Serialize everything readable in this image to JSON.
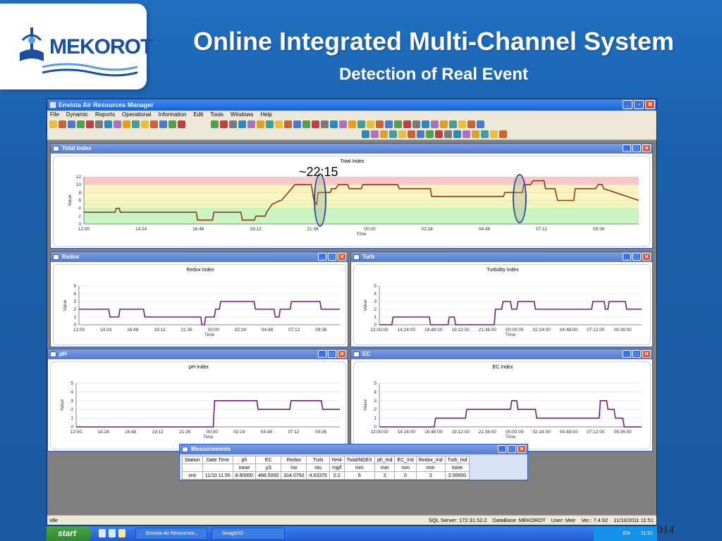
{
  "slide": {
    "logo_text": "MEKOROT",
    "title": "Online Integrated Multi-Channel System",
    "subtitle": "Detection of Real Event",
    "footer_num": "014"
  },
  "app": {
    "title": "Envista Air Resources Manager",
    "menu": [
      "File",
      "Dynamic",
      "Reports",
      "Operational",
      "Information",
      "Edit",
      "Tools",
      "Windows",
      "Help"
    ],
    "status": {
      "left": "Idle",
      "sql": "SQL Server: 172.31.52.2",
      "database": "DataBase: MEKOROT",
      "user": "User: Meir",
      "version": "Ver.: 7.4.92",
      "datetime": "11/10/2011 11:51"
    }
  },
  "windows": {
    "total": {
      "title": "Total Index",
      "chart_title": "Total Index"
    },
    "redox": {
      "title": "Redox",
      "chart_title": "Redox Index"
    },
    "turb": {
      "title": "Turb",
      "chart_title": "Turbidity Index"
    },
    "ph": {
      "title": "pH",
      "chart_title": "pH Index"
    },
    "ec": {
      "title": "EC",
      "chart_title": "EC Index"
    }
  },
  "annotation": "~22:15",
  "measurements": {
    "title": "Measurements",
    "headers": [
      "Station",
      "Date Time",
      "ph",
      "EC",
      "Redox",
      "Turb",
      "NH4",
      "TotalINDEX",
      "ph_Ind",
      "EC_Ind",
      "Redox_Ind",
      "Turb_Ind"
    ],
    "units": [
      "",
      "",
      "none",
      "µS",
      "mv",
      "ntu",
      "mg/l",
      "mm",
      "mm",
      "mm",
      "mm",
      "none"
    ],
    "row": [
      "snir",
      "11/10 11:55",
      "8.60000",
      "486.5000",
      "314.0750",
      "4.83375",
      "0.2",
      "6",
      "2",
      "0",
      "2",
      "2.00000"
    ]
  },
  "taskbar": {
    "start": "start",
    "items": [
      "Envista Air Resources...",
      "SnagIt/32"
    ],
    "tray_lang": "EN",
    "tray_time": "11:51"
  },
  "chart_data": [
    {
      "type": "line",
      "title": "Total Index",
      "xlabel": "Time",
      "ylabel": "Value",
      "ylim": [
        0,
        12
      ],
      "yticks": [
        0,
        2,
        4,
        6,
        8,
        10,
        12
      ],
      "xticks": [
        "12:00",
        "14:24",
        "16:48",
        "19:12",
        "21:36",
        "00:00",
        "02:24",
        "04:48",
        "07:12",
        "09:36"
      ],
      "bands": [
        {
          "from": 0,
          "to": 4,
          "color": "#c8f5c0"
        },
        {
          "from": 4,
          "to": 6,
          "color": "#f2f5b8"
        },
        {
          "from": 6,
          "to": 8,
          "color": "#fbf5c0"
        },
        {
          "from": 8,
          "to": 10,
          "color": "#faf0c0"
        },
        {
          "from": 10,
          "to": 12,
          "color": "#f8c8c8"
        }
      ],
      "series": [
        {
          "color": "#8b3a1a",
          "x_hours": [
            0,
            2.3,
            2.4,
            2.6,
            2.7,
            8.3,
            8.4,
            9.5,
            9.6,
            11.6,
            11.7,
            12.6,
            12.7,
            13.4,
            13.5,
            13.7,
            13.9,
            14.5,
            14.6,
            15.6,
            15.7,
            16.0,
            16.1,
            16.8,
            17.0,
            17.2,
            17.3,
            18.2,
            18.3,
            18.6,
            18.8,
            19.5,
            19.6,
            20.5,
            20.6,
            23.2,
            23.3,
            25.6,
            25.7,
            27.3,
            27.4,
            31.0,
            31.1,
            32.4,
            32.5,
            33.0,
            33.2,
            34.0,
            34.1,
            34.8,
            35.0,
            36.2,
            36.3,
            37.8,
            38.0,
            38.3,
            38.4,
            41.0
          ],
          "values": [
            3,
            3,
            4,
            4,
            3,
            3,
            1,
            1,
            3,
            3,
            1,
            1,
            2,
            2,
            3,
            4,
            5,
            6,
            6,
            10,
            10,
            10,
            10,
            10,
            6,
            5,
            8,
            8,
            9,
            9,
            10,
            10,
            9,
            9,
            10,
            10,
            9,
            9,
            7,
            7,
            7,
            7,
            8,
            8,
            10,
            10,
            11,
            11,
            9,
            9,
            6,
            6,
            9,
            9,
            10,
            10,
            9,
            6
          ]
        }
      ]
    },
    {
      "type": "line",
      "title": "Redox Index",
      "xlabel": "Time",
      "ylabel": "Value",
      "ylim": [
        0,
        5
      ],
      "xticks": [
        "12:00",
        "14:24",
        "16:48",
        "19:12",
        "21:36",
        "00:00",
        "02:24",
        "04:48",
        "07:12",
        "09:36"
      ],
      "series": [
        {
          "color": "#7b1a7b",
          "x_hours": [
            0,
            2.4,
            2.5,
            3.2,
            3.3,
            5.2,
            5.3,
            8.0,
            8.1,
            9.8,
            9.9,
            10.1,
            10.2,
            10.9,
            11.0,
            11.3,
            11.4,
            11.9,
            12.0,
            14.1,
            14.2,
            15.7,
            15.8,
            16.1,
            16.2,
            17.0,
            17.1,
            17.3,
            17.4,
            19.4,
            19.5,
            21.0
          ],
          "values": [
            2,
            2,
            1,
            1,
            2,
            2,
            1,
            1,
            1,
            1,
            0,
            0,
            1,
            1,
            2,
            2,
            3,
            3,
            3,
            3,
            2,
            2,
            1,
            1,
            2,
            2,
            3,
            3,
            3,
            3,
            2,
            2
          ]
        }
      ]
    },
    {
      "type": "line",
      "title": "Turbidity Index",
      "xlabel": "Time",
      "ylabel": "Value",
      "ylim": [
        0,
        5
      ],
      "xticks": [
        "12:00:00",
        "14:24:00",
        "16:48:00",
        "19:12:00",
        "21:36:00",
        "00:00:00",
        "02:24:00",
        "04:48:00",
        "07:12:00",
        "09:36:00"
      ],
      "series": [
        {
          "color": "#7b1a7b",
          "x_hours": [
            0,
            1.0,
            1.1,
            4.0,
            4.1,
            5.5,
            5.6,
            6.0,
            6.1,
            9.2,
            9.3,
            9.8,
            9.9,
            10.5,
            10.6,
            11.0,
            11.1,
            12.4,
            12.5,
            17.0,
            17.1,
            18.0,
            18.1,
            18.3,
            18.4,
            19.7,
            19.8,
            21.0
          ],
          "values": [
            0,
            0,
            1,
            1,
            0,
            0,
            1,
            1,
            0,
            0,
            2,
            2,
            3,
            3,
            2,
            2,
            3,
            3,
            2,
            2,
            3,
            3,
            2,
            2,
            3,
            3,
            2,
            2
          ]
        }
      ]
    },
    {
      "type": "line",
      "title": "pH Index",
      "xlabel": "Time",
      "ylabel": "Value",
      "ylim": [
        0,
        5
      ],
      "xticks": [
        "12:00",
        "14:24",
        "16:48",
        "19:12",
        "21:36",
        "00:00",
        "02:24",
        "04:48",
        "07:12",
        "09:36"
      ],
      "series": [
        {
          "color": "#7b1a7b",
          "x_hours": [
            0,
            10.4,
            10.5,
            10.9,
            11.0,
            12.3,
            12.4,
            13.7,
            13.8,
            16.2,
            16.3,
            17.4,
            17.5,
            18.6,
            18.7,
            20.0
          ],
          "values": [
            0,
            0,
            3,
            3,
            3,
            3,
            3,
            3,
            2,
            2,
            3,
            3,
            3,
            3,
            2,
            2
          ]
        }
      ]
    },
    {
      "type": "line",
      "title": "EC Index",
      "xlabel": "Time",
      "ylabel": "Value",
      "ylim": [
        0,
        5
      ],
      "xticks": [
        "12:00:00",
        "14:24:00",
        "16:48:00",
        "19:12:00",
        "21:36:00",
        "00:00:00",
        "02:24:00",
        "04:48:00",
        "07:12:00",
        "09:36:00"
      ],
      "series": [
        {
          "color": "#7b1a7b",
          "x_hours": [
            0,
            4.4,
            4.5,
            6.9,
            7.0,
            8.3,
            8.4,
            10.5,
            10.6,
            11.0,
            11.1,
            11.5,
            11.6,
            12.5,
            12.6,
            17.6,
            17.7,
            18.2,
            18.3,
            18.8,
            18.9,
            19.5,
            19.6,
            21.0
          ],
          "values": [
            0,
            0,
            1,
            1,
            2,
            2,
            2,
            2,
            3,
            3,
            2,
            2,
            2,
            2,
            1,
            1,
            3,
            3,
            2,
            2,
            1,
            1,
            0,
            0
          ]
        }
      ]
    }
  ]
}
